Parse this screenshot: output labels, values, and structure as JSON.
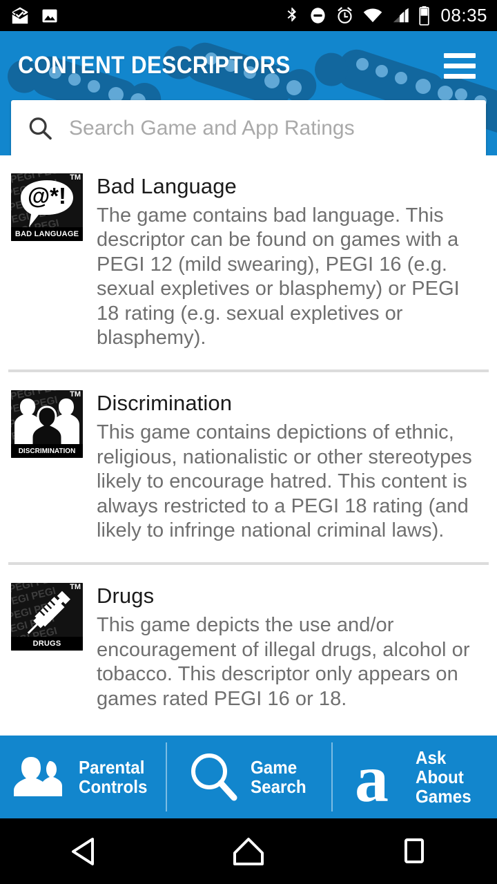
{
  "status_bar": {
    "time": "08:35",
    "left_icons": [
      "mail-read-icon",
      "image-icon"
    ],
    "right_icons": [
      "bluetooth-icon",
      "do-not-disturb-icon",
      "alarm-icon",
      "wifi-icon",
      "cellular-signal-icon",
      "battery-icon"
    ]
  },
  "header": {
    "title": "CONTENT DESCRIPTORS",
    "menu_icon": "hamburger-menu-icon",
    "accent_color": "#1286cd"
  },
  "search": {
    "placeholder": "Search Game and App Ratings",
    "value": "",
    "icon": "search-icon"
  },
  "descriptors": [
    {
      "title": "Bad Language",
      "description": "The game contains bad language. This descriptor can be found on games with a PEGI 12 (mild swearing), PEGI 16 (e.g. sexual expletives or blasphemy) or PEGI 18 rating (e.g. sexual expletives or blasphemy).",
      "badge_caption": "BAD LANGUAGE",
      "badge_symbol": "@*!",
      "badge_tm": "TM",
      "badge_icon": "pegi-bad-language-icon"
    },
    {
      "title": "Discrimination",
      "description": "This game contains depictions of ethnic, religious, nationalistic or other stereotypes likely to encourage hatred. This content is always restricted to a PEGI 18 rating (and likely to infringe national criminal laws).",
      "badge_caption": "DISCRIMINATION",
      "badge_symbol": "",
      "badge_tm": "TM",
      "badge_icon": "pegi-discrimination-icon"
    },
    {
      "title": "Drugs",
      "description": "This game depicts the use and/or encouragement of illegal drugs, alcohol or tobacco. This descriptor only appears on games rated PEGI 16 or 18.",
      "badge_caption": "DRUGS",
      "badge_symbol": "",
      "badge_tm": "TM",
      "badge_icon": "pegi-drugs-icon"
    }
  ],
  "bottom_nav": [
    {
      "label_line1": "Parental",
      "label_line2": "Controls",
      "label_line3": "",
      "icon": "two-people-icon"
    },
    {
      "label_line1": "Game",
      "label_line2": "Search",
      "label_line3": "",
      "icon": "magnifier-icon"
    },
    {
      "label_line1": "Ask",
      "label_line2": "About",
      "label_line3": "Games",
      "icon": "askaboutgames-a-logo"
    }
  ],
  "android_nav": {
    "back": "back-triangle-icon",
    "home": "home-icon",
    "recents": "recents-square-icon"
  }
}
